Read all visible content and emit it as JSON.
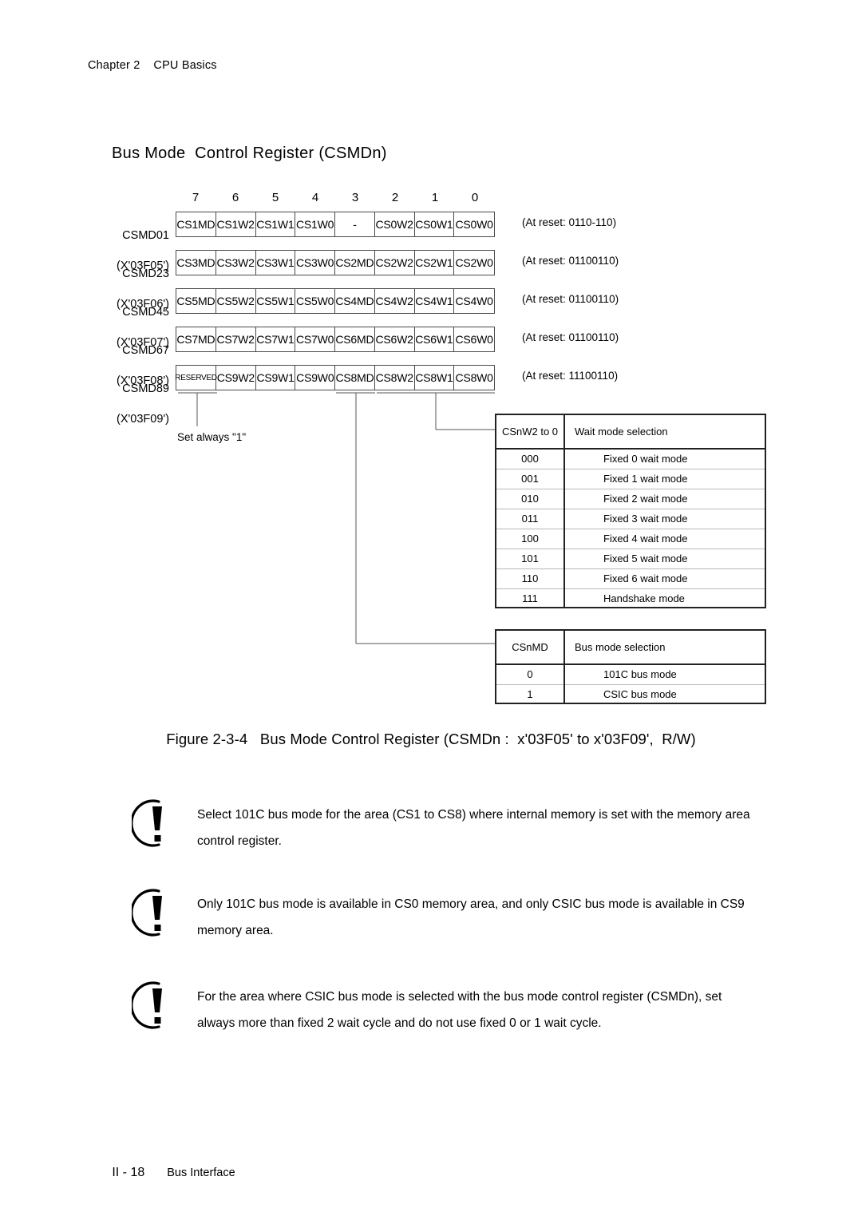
{
  "header": {
    "chapter": "Chapter 2    CPU Basics"
  },
  "section": {
    "title": "Bus Mode  Control Register (CSMDn)"
  },
  "figure": {
    "bit_indices": [
      "7",
      "6",
      "5",
      "4",
      "3",
      "2",
      "1",
      "0"
    ],
    "registers": [
      {
        "name": "CSMD01",
        "address": "(X'03F05')",
        "bits": [
          "CS1MD",
          "CS1W2",
          "CS1W1",
          "CS1W0",
          "-",
          "CS0W2",
          "CS0W1",
          "CS0W0"
        ],
        "reset": "(At reset: 0110-110)"
      },
      {
        "name": "CSMD23",
        "address": "(X'03F06')",
        "bits": [
          "CS3MD",
          "CS3W2",
          "CS3W1",
          "CS3W0",
          "CS2MD",
          "CS2W2",
          "CS2W1",
          "CS2W0"
        ],
        "reset": "(At reset: 01100110)"
      },
      {
        "name": "CSMD45",
        "address": "(X'03F07')",
        "bits": [
          "CS5MD",
          "CS5W2",
          "CS5W1",
          "CS5W0",
          "CS4MD",
          "CS4W2",
          "CS4W1",
          "CS4W0"
        ],
        "reset": "(At reset: 01100110)"
      },
      {
        "name": "CSMD67",
        "address": "(X'03F08')",
        "bits": [
          "CS7MD",
          "CS7W2",
          "CS7W1",
          "CS7W0",
          "CS6MD",
          "CS6W2",
          "CS6W1",
          "CS6W0"
        ],
        "reset": "(At reset: 01100110)"
      },
      {
        "name": "CSMD89",
        "address": "(X'03F09')",
        "bits": [
          "RESERVED",
          "CS9W2",
          "CS9W1",
          "CS9W0",
          "CS8MD",
          "CS8W2",
          "CS8W1",
          "CS8W0"
        ],
        "reset": "(At reset: 11100110)"
      }
    ],
    "set_always_note": "Set always \"1\"",
    "wait_mode_table": {
      "header_code": "CSnW2 to 0",
      "header_desc": "Wait mode selection",
      "rows": [
        {
          "code": "000",
          "desc": "Fixed 0 wait mode"
        },
        {
          "code": "001",
          "desc": "Fixed 1 wait mode"
        },
        {
          "code": "010",
          "desc": "Fixed 2 wait mode"
        },
        {
          "code": "011",
          "desc": "Fixed 3 wait mode"
        },
        {
          "code": "100",
          "desc": "Fixed 4 wait mode"
        },
        {
          "code": "101",
          "desc": "Fixed 5 wait mode"
        },
        {
          "code": "110",
          "desc": "Fixed 6 wait mode"
        },
        {
          "code": "111",
          "desc": "Handshake mode"
        }
      ]
    },
    "bus_mode_table": {
      "header_code": "CSnMD",
      "header_desc": "Bus mode selection",
      "rows": [
        {
          "code": "0",
          "desc": "101C bus mode"
        },
        {
          "code": "1",
          "desc": "CSIC bus mode"
        }
      ]
    },
    "caption": "Figure 2-3-4   Bus Mode Control Register (CSMDn :  x'03F05' to x'03F09',  R/W)"
  },
  "notes": [
    "Select 101C bus mode for the area (CS1 to CS8) where internal memory is set with the memory area control register.",
    "Only 101C bus mode is available in CS0 memory area, and only CSIC bus mode is available in CS9 memory area.",
    "For the area where CSIC bus mode is selected with the bus mode control register (CSMDn), set always more than fixed 2 wait cycle and do not use fixed 0 or 1 wait cycle."
  ],
  "footer": {
    "page_number": "II - 18",
    "title": "Bus Interface"
  }
}
